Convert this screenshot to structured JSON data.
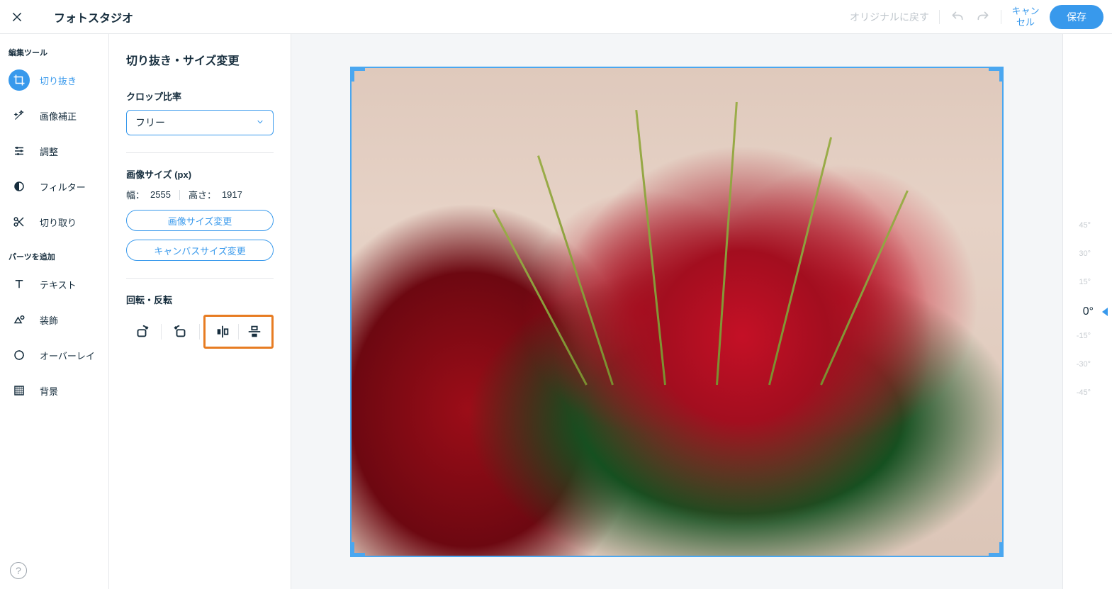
{
  "header": {
    "title": "フォトスタジオ",
    "reset_label": "オリジナルに戻す",
    "cancel_label": "キャンセル",
    "save_label": "保存"
  },
  "tools": {
    "edit_section": "編集ツール",
    "parts_section": "パーツを追加",
    "items_edit": [
      {
        "name": "crop",
        "label": "切り抜き",
        "active": true
      },
      {
        "name": "auto-fix",
        "label": "画像補正"
      },
      {
        "name": "adjust",
        "label": "調整"
      },
      {
        "name": "filter",
        "label": "フィルター"
      },
      {
        "name": "cut",
        "label": "切り取り"
      }
    ],
    "items_parts": [
      {
        "name": "text",
        "label": "テキスト"
      },
      {
        "name": "decor",
        "label": "装飾"
      },
      {
        "name": "overlay",
        "label": "オーバーレイ"
      },
      {
        "name": "background",
        "label": "背景"
      }
    ]
  },
  "panel": {
    "title": "切り抜き・サイズ変更",
    "ratio_label": "クロップ比率",
    "ratio_value": "フリー",
    "size_label": "画像サイズ (px)",
    "width_label": "幅：",
    "width_value": "2555",
    "height_label": "高さ：",
    "height_value": "1917",
    "resize_btn": "画像サイズ変更",
    "canvas_btn": "キャンバスサイズ変更",
    "rotate_label": "回転・反転"
  },
  "rotation": {
    "ticks": [
      "45°",
      "30°",
      "15°",
      "-15°",
      "-30°",
      "-45°"
    ],
    "current": "0°"
  }
}
